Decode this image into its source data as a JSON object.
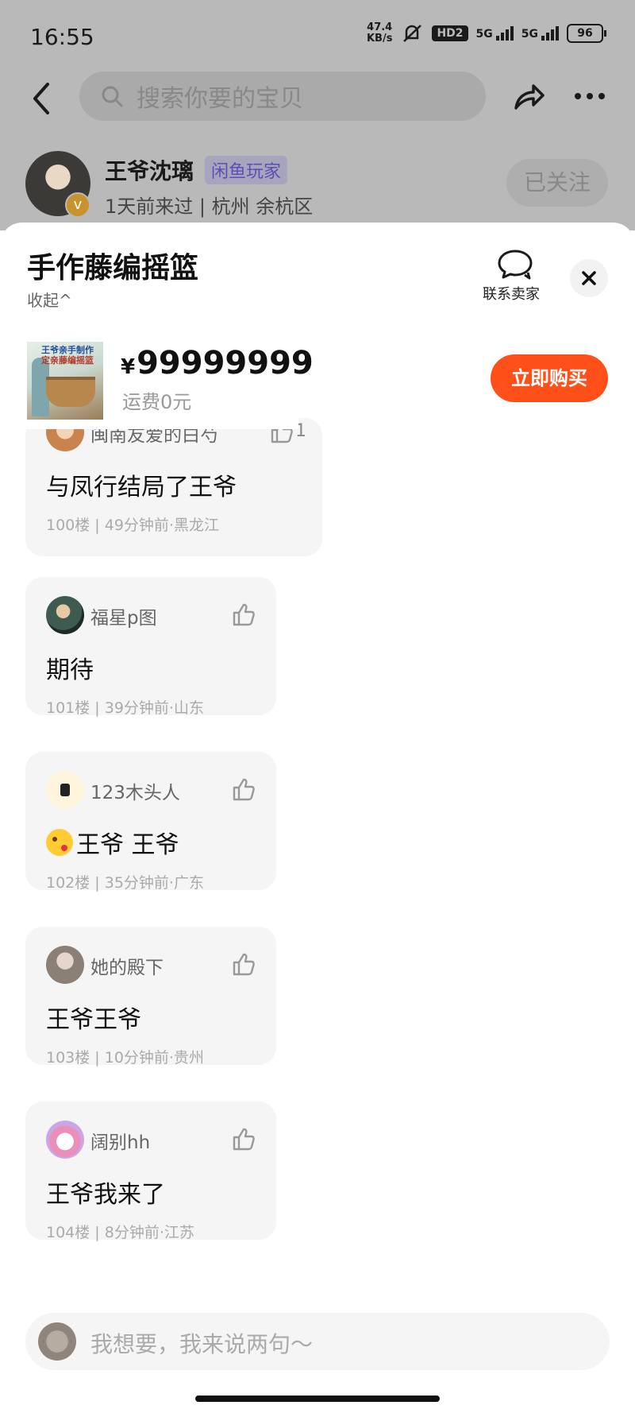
{
  "status_bar": {
    "time": "16:55",
    "net_speed_value": "47.4",
    "net_speed_unit": "KB/s",
    "hd_label": "HD2",
    "signal1_label": "5G",
    "signal2_label": "5G",
    "battery": "96"
  },
  "nav": {
    "search_placeholder": "搜索你要的宝贝"
  },
  "seller": {
    "name": "王爷沈璃",
    "tag": "闲鱼玩家",
    "meta": "1天前来过 | 杭州 余杭区",
    "follow_label": "已关注"
  },
  "sheet": {
    "title": "手作藤编摇篮",
    "collapse_label": "收起^",
    "contact_label": "联系卖家",
    "thumb_text_line1": "王爷亲手制作",
    "thumb_text_line2": "定亲藤编摇篮",
    "price_symbol": "¥",
    "price": "99999999",
    "shipping": "运费0元",
    "buy_label": "立即购买"
  },
  "comments": [
    {
      "user": "闽南友爱的白芍",
      "text": "与凤行结局了王爷",
      "meta": "100楼 | 49分钟前·黑龙江",
      "likes": "1"
    },
    {
      "user": "福星p图",
      "text": "期待",
      "meta": "101楼 | 39分钟前·山东",
      "likes": ""
    },
    {
      "user": "123木头人",
      "text": "王爷 王爷",
      "meta": "102楼 | 35分钟前·广东",
      "likes": ""
    },
    {
      "user": "她的殿下",
      "text": "王爷王爷",
      "meta": "103楼 | 10分钟前·贵州",
      "likes": ""
    },
    {
      "user": "阔别hh",
      "text": "王爷我来了",
      "meta": "104楼 | 8分钟前·江苏",
      "likes": ""
    }
  ],
  "input": {
    "placeholder": "我想要，我来说两句～"
  }
}
